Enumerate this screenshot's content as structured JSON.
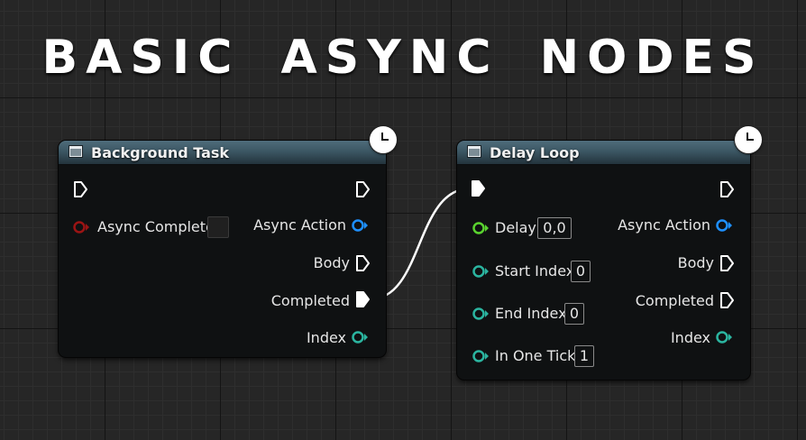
{
  "page": {
    "title": "BASIC ASYNC NODES"
  },
  "colors": {
    "background": "#262626",
    "node_body": "#0f1112",
    "exec_pin": "#ffffff",
    "async_action_pin": "#1e90ff",
    "integer_pin": "#2bb5a0",
    "float_pin": "#5ad32f",
    "event_pin": "#9b1414"
  },
  "nodes": {
    "background_task": {
      "title": "Background Task",
      "inputs": {
        "async_complete": "Async Complete"
      },
      "outputs": {
        "async_action": "Async Action",
        "body": "Body",
        "completed": "Completed",
        "index": "Index"
      }
    },
    "delay_loop": {
      "title": "Delay Loop",
      "inputs": {
        "delay": {
          "label": "Delay",
          "value": "0,0"
        },
        "start_index": {
          "label": "Start Index",
          "value": "0"
        },
        "end_index": {
          "label": "End Index",
          "value": "0"
        },
        "in_one_tick": {
          "label": "In One Tick",
          "value": "1"
        }
      },
      "outputs": {
        "async_action": "Async Action",
        "body": "Body",
        "completed": "Completed",
        "index": "Index"
      }
    }
  }
}
